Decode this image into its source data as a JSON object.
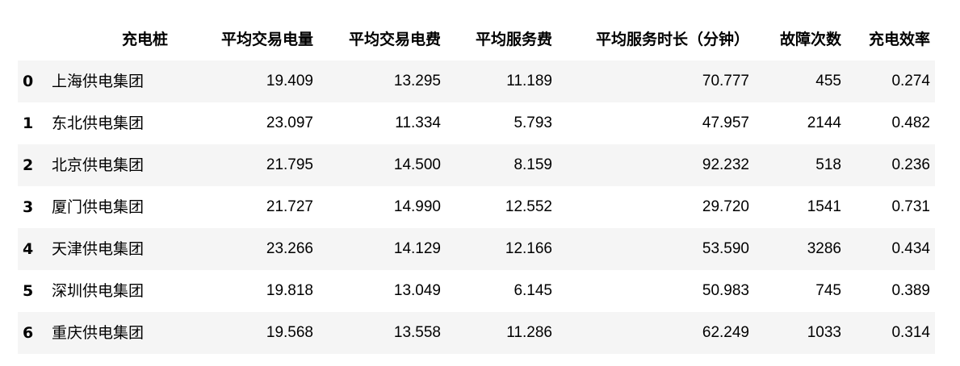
{
  "table": {
    "columns": [
      "",
      "充电桩",
      "平均交易电量",
      "平均交易电费",
      "平均服务费",
      "平均服务时长（分钟）",
      "故障次数",
      "充电效率"
    ],
    "rows": [
      {
        "index": "0",
        "name": "上海供电集团",
        "avg_energy": "19.409",
        "avg_fee": "13.295",
        "avg_service_fee": "11.189",
        "avg_duration": "70.777",
        "faults": "455",
        "efficiency": "0.274"
      },
      {
        "index": "1",
        "name": "东北供电集团",
        "avg_energy": "23.097",
        "avg_fee": "11.334",
        "avg_service_fee": "5.793",
        "avg_duration": "47.957",
        "faults": "2144",
        "efficiency": "0.482"
      },
      {
        "index": "2",
        "name": "北京供电集团",
        "avg_energy": "21.795",
        "avg_fee": "14.500",
        "avg_service_fee": "8.159",
        "avg_duration": "92.232",
        "faults": "518",
        "efficiency": "0.236"
      },
      {
        "index": "3",
        "name": "厦门供电集团",
        "avg_energy": "21.727",
        "avg_fee": "14.990",
        "avg_service_fee": "12.552",
        "avg_duration": "29.720",
        "faults": "1541",
        "efficiency": "0.731"
      },
      {
        "index": "4",
        "name": "天津供电集团",
        "avg_energy": "23.266",
        "avg_fee": "14.129",
        "avg_service_fee": "12.166",
        "avg_duration": "53.590",
        "faults": "3286",
        "efficiency": "0.434"
      },
      {
        "index": "5",
        "name": "深圳供电集团",
        "avg_energy": "19.818",
        "avg_fee": "13.049",
        "avg_service_fee": "6.145",
        "avg_duration": "50.983",
        "faults": "745",
        "efficiency": "0.389"
      },
      {
        "index": "6",
        "name": "重庆供电集团",
        "avg_energy": "19.568",
        "avg_fee": "13.558",
        "avg_service_fee": "11.286",
        "avg_duration": "62.249",
        "faults": "1033",
        "efficiency": "0.314"
      }
    ]
  },
  "colors": {
    "stripe": "#f5f5f5",
    "background": "#ffffff",
    "text": "#000000"
  }
}
